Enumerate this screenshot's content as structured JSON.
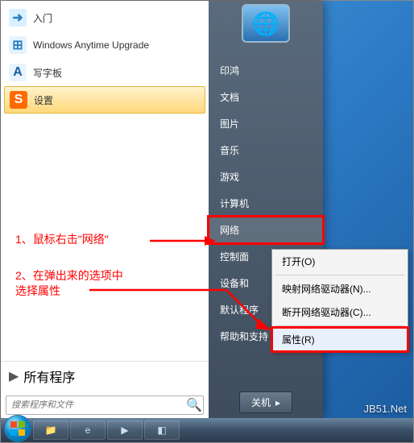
{
  "left_items": [
    {
      "label": "入门",
      "iconBg": "#d9f0ff",
      "iconGlyph": "➜",
      "iconColor": "#2a80c0"
    },
    {
      "label": "Windows Anytime Upgrade",
      "iconBg": "#e6f3ff",
      "iconGlyph": "⊞",
      "iconColor": "#2a80c0"
    },
    {
      "label": "写字板",
      "iconBg": "#eaf4ff",
      "iconGlyph": "A",
      "iconColor": "#1560a0"
    },
    {
      "label": "设置",
      "iconBg": "#ff6a00",
      "iconGlyph": "S",
      "iconColor": "#fff",
      "selected": true
    }
  ],
  "all_programs_label": "所有程序",
  "search_placeholder": "搜索程序和文件",
  "right_items": [
    {
      "label": "印鸿"
    },
    {
      "label": "文档"
    },
    {
      "label": "图片"
    },
    {
      "label": "音乐"
    },
    {
      "label": "游戏"
    },
    {
      "label": "计算机"
    },
    {
      "label": "网络",
      "highlight": true
    },
    {
      "label": "控制面"
    },
    {
      "label": "设备和"
    },
    {
      "label": "默认程序"
    },
    {
      "label": "帮助和支持"
    }
  ],
  "shutdown_label": "关机",
  "context_menu": [
    {
      "label": "打开(O)"
    },
    {
      "sep": true
    },
    {
      "label": "映射网络驱动器(N)..."
    },
    {
      "label": "断开网络驱动器(C)..."
    },
    {
      "sep": true
    },
    {
      "label": "属性(R)",
      "highlight": true
    }
  ],
  "annotations": {
    "a1": "1、鼠标右击\"网络\"",
    "a2_l1": "2、在弹出来的选项中",
    "a2_l2": "选择属性"
  },
  "watermark": "JB51.Net",
  "colors": {
    "highlight": "#ff0000"
  }
}
